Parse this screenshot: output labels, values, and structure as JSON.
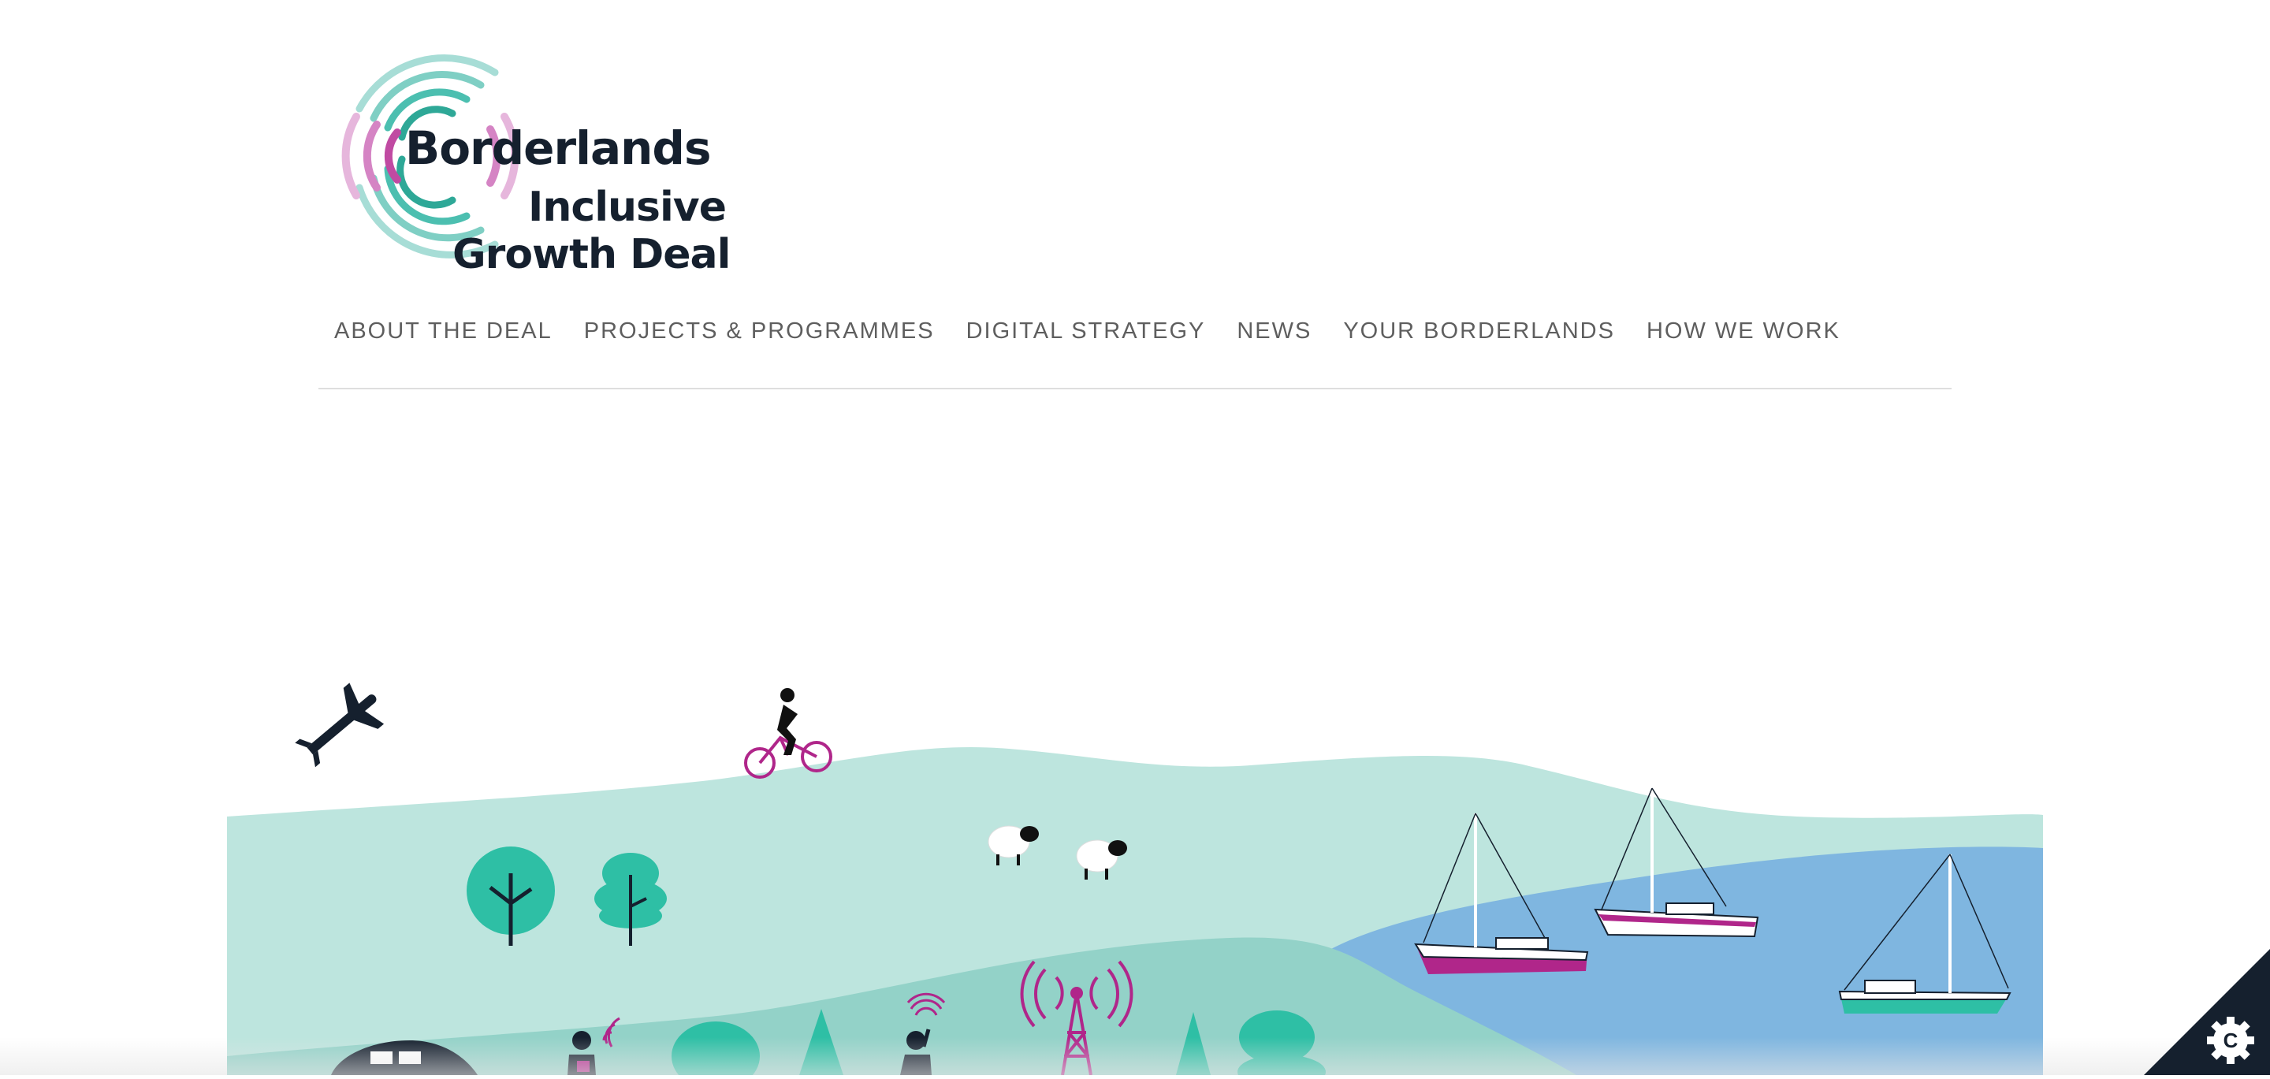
{
  "logo": {
    "line1": "Borderlands",
    "line2": "Inclusive",
    "line3": "Growth Deal"
  },
  "nav": {
    "items": [
      {
        "label": "ABOUT THE DEAL"
      },
      {
        "label": "PROJECTS & PROGRAMMES"
      },
      {
        "label": "DIGITAL STRATEGY"
      },
      {
        "label": "NEWS"
      },
      {
        "label": "YOUR BORDERLANDS"
      },
      {
        "label": "HOW WE WORK"
      }
    ]
  },
  "colors": {
    "brand_teal": "#2ebfa5",
    "brand_magenta": "#b0268a",
    "navy": "#15202e",
    "hill_light": "#bde5de",
    "hill_mid": "#93d2c8",
    "water": "#7fb6e0"
  },
  "icons": {
    "plane": "plane-icon",
    "cyclist": "cyclist-icon",
    "cookie": "cookie-settings-icon"
  }
}
